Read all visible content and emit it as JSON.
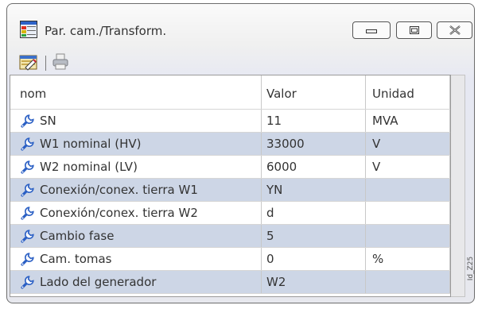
{
  "window": {
    "title": "Par. cam./Transform."
  },
  "toolbar": {
    "items": [
      "edit-icon",
      "print-icon"
    ]
  },
  "table": {
    "columns": [
      "nom",
      "Valor",
      "Unidad"
    ],
    "rows": [
      {
        "name": "SN",
        "value": "11",
        "unit": "MVA"
      },
      {
        "name": "W1 nominal (HV)",
        "value": "33000",
        "unit": "V"
      },
      {
        "name": "W2 nominal (LV)",
        "value": "6000",
        "unit": "V"
      },
      {
        "name": "Conexión/conex. tierra W1",
        "value": "YN",
        "unit": ""
      },
      {
        "name": "Conexión/conex. tierra W2",
        "value": "d",
        "unit": ""
      },
      {
        "name": "Cambio fase",
        "value": "5",
        "unit": ""
      },
      {
        "name": "Cam. tomas",
        "value": "0",
        "unit": "%"
      },
      {
        "name": "Lado del generador",
        "value": "W2",
        "unit": ""
      }
    ]
  },
  "image_id": "Id_Z25",
  "colors": {
    "row_alt": "#cdd6e6",
    "icon_blue": "#2a5fc4"
  }
}
